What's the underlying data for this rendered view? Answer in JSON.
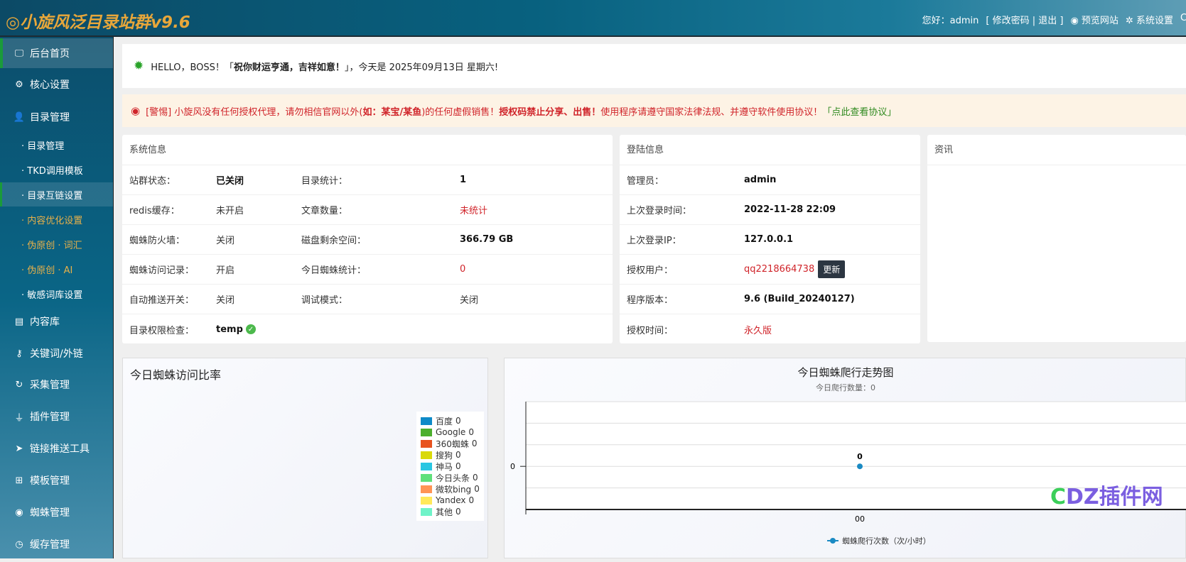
{
  "header": {
    "logo": "◎小旋风泛目录站群v9.6",
    "greeting": "您好：admin",
    "change_pwd": "[ 修改密码",
    "logout": "| 退出 ]",
    "preview": "预览网站",
    "settings": "系统设置"
  },
  "sidebar": {
    "items": [
      {
        "label": "后台首页",
        "icon": "monitor-icon",
        "glyph": "🖵"
      },
      {
        "label": "核心设置",
        "icon": "gear-icon",
        "glyph": "⚙"
      },
      {
        "label": "目录管理",
        "icon": "user-icon",
        "glyph": "👤"
      },
      {
        "label": "内容库",
        "icon": "list-icon",
        "glyph": "▤"
      },
      {
        "label": "关键词/外链",
        "icon": "key-icon",
        "glyph": "⚷"
      },
      {
        "label": "采集管理",
        "icon": "refresh-icon",
        "glyph": "↻"
      },
      {
        "label": "插件管理",
        "icon": "plug-icon",
        "glyph": "⏚"
      },
      {
        "label": "链接推送工具",
        "icon": "send-icon",
        "glyph": "➤"
      },
      {
        "label": "模板管理",
        "icon": "windows-icon",
        "glyph": "⊞"
      },
      {
        "label": "蜘蛛管理",
        "icon": "android-icon",
        "glyph": "◉"
      },
      {
        "label": "缓存管理",
        "icon": "timer-icon",
        "glyph": "◷"
      }
    ],
    "subs": [
      "· 目录管理",
      "· TKD调用模板",
      "· 目录互链设置",
      "· 内容优化设置",
      "· 伪原创 · 词汇",
      "· 伪原创 · AI",
      "· 敏感词库设置"
    ]
  },
  "welcome": {
    "prefix": "HELLO，BOSS！「",
    "bold": "祝你财运亨通，吉祥如意！",
    "suffix": "」，今天是 2025年09月13日 星期六!"
  },
  "warning": {
    "t1": "[警惕] 小旋风没有任何授权代理，请勿相信官网以外(",
    "b1": "如：某宝/某鱼",
    "t2": ")的任何虚假销售！",
    "b2": "授权码禁止分享、出售！",
    "t3": "使用程序请遵守国家法律法规、并遵守软件使用协议！",
    "link": "「点此查看协议」"
  },
  "system": {
    "title": "系统信息",
    "rows": [
      {
        "k1": "站群状态：",
        "v1": "已关闭",
        "k2": "目录统计：",
        "v2": "1"
      },
      {
        "k1": "redis缓存：",
        "v1": "未开启",
        "k2": "文章数量：",
        "v2": "未统计"
      },
      {
        "k1": "蜘蛛防火墙：",
        "v1": "关闭",
        "k2": "磁盘剩余空间：",
        "v2": "366.79 GB"
      },
      {
        "k1": "蜘蛛访问记录：",
        "v1": "开启",
        "k2": "今日蜘蛛统计：",
        "v2": "0"
      },
      {
        "k1": "自动推送开关：",
        "v1": "关闭",
        "k2": "调试模式：",
        "v2": "关闭"
      },
      {
        "k1": "目录权限检查：",
        "v1": "temp",
        "k2": "",
        "v2": ""
      }
    ]
  },
  "login": {
    "title": "登陆信息",
    "rows": [
      {
        "k": "管理员：",
        "v": "admin"
      },
      {
        "k": "上次登录时间：",
        "v": "2022-11-28 22:09"
      },
      {
        "k": "上次登录IP：",
        "v": "127.0.0.1"
      },
      {
        "k": "授权用户：",
        "v": "qq2218664738",
        "btn": "更新"
      },
      {
        "k": "程序版本：",
        "v": "9.6 (Build_20240127)"
      },
      {
        "k": "授权时间：",
        "v": "永久版"
      }
    ]
  },
  "news": {
    "title": "资讯"
  },
  "chart_data": [
    {
      "type": "pie",
      "title": "今日蜘蛛访问比率",
      "legend_position": "right",
      "series": [
        {
          "name": "百度",
          "value": 0,
          "color": "#0e8ac8"
        },
        {
          "name": "Google",
          "value": 0,
          "color": "#4caf2d"
        },
        {
          "name": "360蜘蛛",
          "value": 0,
          "color": "#e8531f"
        },
        {
          "name": "搜狗",
          "value": 0,
          "color": "#d9d90a"
        },
        {
          "name": "神马",
          "value": 0,
          "color": "#2ac6e2"
        },
        {
          "name": "今日头条",
          "value": 0,
          "color": "#5fe07a"
        },
        {
          "name": "微软bing",
          "value": 0,
          "color": "#ff9455"
        },
        {
          "name": "Yandex",
          "value": 0,
          "color": "#ffe95a"
        },
        {
          "name": "其他",
          "value": 0,
          "color": "#6ff3c8"
        }
      ]
    },
    {
      "type": "line",
      "title": "今日蜘蛛爬行走势图",
      "subtitle": "今日爬行数量：0",
      "categories": [
        "00"
      ],
      "series": [
        {
          "name": "蜘蛛爬行次数（次/小时）",
          "values": [
            0
          ],
          "color": "#1a8ac3"
        }
      ],
      "yticks": [
        "0"
      ],
      "grid": true,
      "legend_position": "bottom"
    }
  ],
  "watermark": "DZ插件网"
}
